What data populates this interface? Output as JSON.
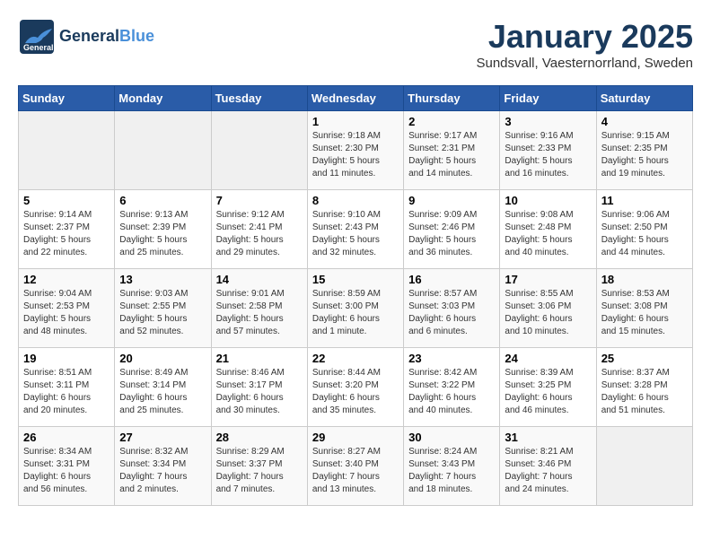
{
  "header": {
    "logo_general": "General",
    "logo_blue": "Blue",
    "month_title": "January 2025",
    "subtitle": "Sundsvall, Vaesternorrland, Sweden"
  },
  "days_of_week": [
    "Sunday",
    "Monday",
    "Tuesday",
    "Wednesday",
    "Thursday",
    "Friday",
    "Saturday"
  ],
  "weeks": [
    [
      {
        "day": "",
        "info": ""
      },
      {
        "day": "",
        "info": ""
      },
      {
        "day": "",
        "info": ""
      },
      {
        "day": "1",
        "info": "Sunrise: 9:18 AM\nSunset: 2:30 PM\nDaylight: 5 hours\nand 11 minutes."
      },
      {
        "day": "2",
        "info": "Sunrise: 9:17 AM\nSunset: 2:31 PM\nDaylight: 5 hours\nand 14 minutes."
      },
      {
        "day": "3",
        "info": "Sunrise: 9:16 AM\nSunset: 2:33 PM\nDaylight: 5 hours\nand 16 minutes."
      },
      {
        "day": "4",
        "info": "Sunrise: 9:15 AM\nSunset: 2:35 PM\nDaylight: 5 hours\nand 19 minutes."
      }
    ],
    [
      {
        "day": "5",
        "info": "Sunrise: 9:14 AM\nSunset: 2:37 PM\nDaylight: 5 hours\nand 22 minutes."
      },
      {
        "day": "6",
        "info": "Sunrise: 9:13 AM\nSunset: 2:39 PM\nDaylight: 5 hours\nand 25 minutes."
      },
      {
        "day": "7",
        "info": "Sunrise: 9:12 AM\nSunset: 2:41 PM\nDaylight: 5 hours\nand 29 minutes."
      },
      {
        "day": "8",
        "info": "Sunrise: 9:10 AM\nSunset: 2:43 PM\nDaylight: 5 hours\nand 32 minutes."
      },
      {
        "day": "9",
        "info": "Sunrise: 9:09 AM\nSunset: 2:46 PM\nDaylight: 5 hours\nand 36 minutes."
      },
      {
        "day": "10",
        "info": "Sunrise: 9:08 AM\nSunset: 2:48 PM\nDaylight: 5 hours\nand 40 minutes."
      },
      {
        "day": "11",
        "info": "Sunrise: 9:06 AM\nSunset: 2:50 PM\nDaylight: 5 hours\nand 44 minutes."
      }
    ],
    [
      {
        "day": "12",
        "info": "Sunrise: 9:04 AM\nSunset: 2:53 PM\nDaylight: 5 hours\nand 48 minutes."
      },
      {
        "day": "13",
        "info": "Sunrise: 9:03 AM\nSunset: 2:55 PM\nDaylight: 5 hours\nand 52 minutes."
      },
      {
        "day": "14",
        "info": "Sunrise: 9:01 AM\nSunset: 2:58 PM\nDaylight: 5 hours\nand 57 minutes."
      },
      {
        "day": "15",
        "info": "Sunrise: 8:59 AM\nSunset: 3:00 PM\nDaylight: 6 hours\nand 1 minute."
      },
      {
        "day": "16",
        "info": "Sunrise: 8:57 AM\nSunset: 3:03 PM\nDaylight: 6 hours\nand 6 minutes."
      },
      {
        "day": "17",
        "info": "Sunrise: 8:55 AM\nSunset: 3:06 PM\nDaylight: 6 hours\nand 10 minutes."
      },
      {
        "day": "18",
        "info": "Sunrise: 8:53 AM\nSunset: 3:08 PM\nDaylight: 6 hours\nand 15 minutes."
      }
    ],
    [
      {
        "day": "19",
        "info": "Sunrise: 8:51 AM\nSunset: 3:11 PM\nDaylight: 6 hours\nand 20 minutes."
      },
      {
        "day": "20",
        "info": "Sunrise: 8:49 AM\nSunset: 3:14 PM\nDaylight: 6 hours\nand 25 minutes."
      },
      {
        "day": "21",
        "info": "Sunrise: 8:46 AM\nSunset: 3:17 PM\nDaylight: 6 hours\nand 30 minutes."
      },
      {
        "day": "22",
        "info": "Sunrise: 8:44 AM\nSunset: 3:20 PM\nDaylight: 6 hours\nand 35 minutes."
      },
      {
        "day": "23",
        "info": "Sunrise: 8:42 AM\nSunset: 3:22 PM\nDaylight: 6 hours\nand 40 minutes."
      },
      {
        "day": "24",
        "info": "Sunrise: 8:39 AM\nSunset: 3:25 PM\nDaylight: 6 hours\nand 46 minutes."
      },
      {
        "day": "25",
        "info": "Sunrise: 8:37 AM\nSunset: 3:28 PM\nDaylight: 6 hours\nand 51 minutes."
      }
    ],
    [
      {
        "day": "26",
        "info": "Sunrise: 8:34 AM\nSunset: 3:31 PM\nDaylight: 6 hours\nand 56 minutes."
      },
      {
        "day": "27",
        "info": "Sunrise: 8:32 AM\nSunset: 3:34 PM\nDaylight: 7 hours\nand 2 minutes."
      },
      {
        "day": "28",
        "info": "Sunrise: 8:29 AM\nSunset: 3:37 PM\nDaylight: 7 hours\nand 7 minutes."
      },
      {
        "day": "29",
        "info": "Sunrise: 8:27 AM\nSunset: 3:40 PM\nDaylight: 7 hours\nand 13 minutes."
      },
      {
        "day": "30",
        "info": "Sunrise: 8:24 AM\nSunset: 3:43 PM\nDaylight: 7 hours\nand 18 minutes."
      },
      {
        "day": "31",
        "info": "Sunrise: 8:21 AM\nSunset: 3:46 PM\nDaylight: 7 hours\nand 24 minutes."
      },
      {
        "day": "",
        "info": ""
      }
    ]
  ]
}
